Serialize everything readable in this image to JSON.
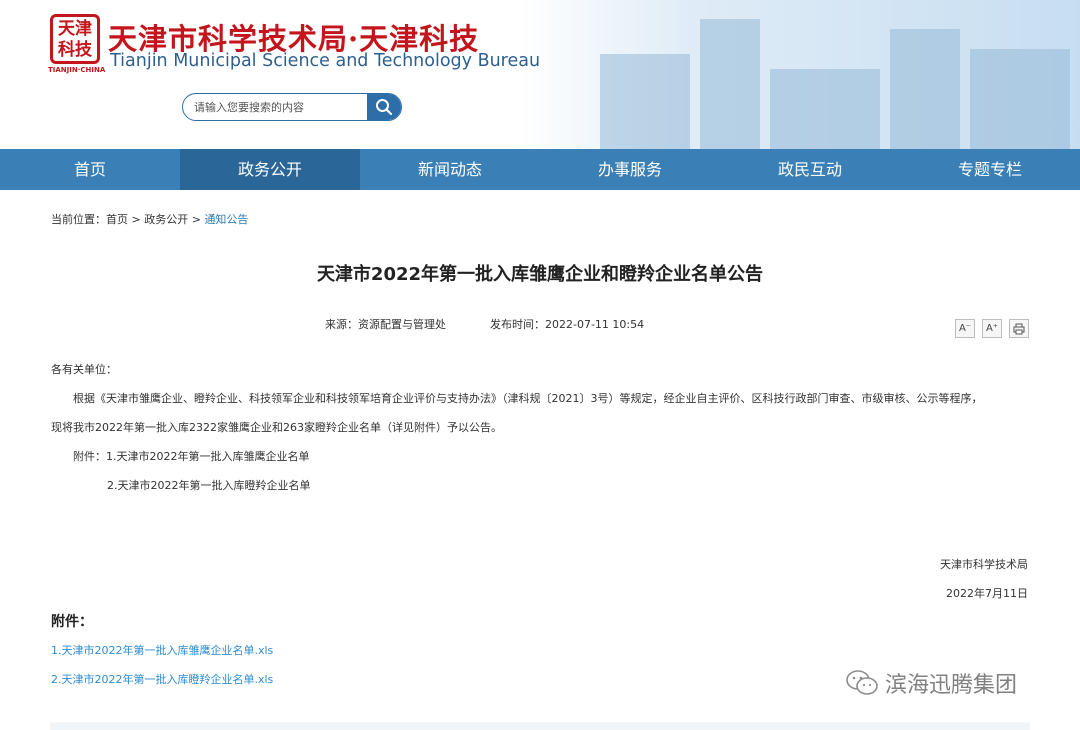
{
  "header": {
    "seal_text": "天津\n科技",
    "seal_caption": "TIANJIN·CHINA",
    "title": "天津市科学技术局·天津科技",
    "subtitle": "Tianjin Municipal Science and Technology Bureau",
    "search_placeholder": "请输入您要搜索的内容"
  },
  "nav": {
    "items": [
      {
        "label": "首页"
      },
      {
        "label": "政务公开"
      },
      {
        "label": "新闻动态"
      },
      {
        "label": "办事服务"
      },
      {
        "label": "政民互动"
      },
      {
        "label": "专题专栏"
      }
    ],
    "active_index": 1
  },
  "breadcrumb": {
    "prefix": "当前位置：",
    "home": "首页",
    "sep": " > ",
    "section": "政务公开",
    "current": "通知公告"
  },
  "article": {
    "title": "天津市2022年第一批入库雏鹰企业和瞪羚企业名单公告",
    "source": "来源：资源配置与管理处",
    "published": "发布时间：2022-07-11 10:54",
    "tools": {
      "font_smaller": "A⁻",
      "font_larger": "A⁺",
      "print": "⎙"
    },
    "salutation": "各有关单位：",
    "para_line1": "根据《天津市雏鹰企业、瞪羚企业、科技领军企业和科技领军培育企业评价与支持办法》（津科规〔2021〕3号）等规定，经企业自主评价、区科技行政部门审查、市级审核、公示等程序，",
    "para_line2": "现将我市2022年第一批入库2322家雏鹰企业和263家瞪羚企业名单（详见附件）予以公告。",
    "attach_line1": "附件：1.天津市2022年第一批入库雏鹰企业名单",
    "attach_line2": "2.天津市2022年第一批入库瞪羚企业名单",
    "signature": "天津市科学技术局",
    "date": "2022年7月11日"
  },
  "attachments": {
    "heading": "附件：",
    "files": [
      {
        "label": "1.天津市2022年第一批入库雏鹰企业名单.xls"
      },
      {
        "label": "2.天津市2022年第一批入库瞪羚企业名单.xls"
      }
    ]
  },
  "watermark": {
    "text": "滨海迅腾集团"
  },
  "colors": {
    "brand_red": "#c3151b",
    "nav_blue": "#3a7fb6",
    "nav_active": "#2a6798",
    "link_blue": "#2d8cd1"
  }
}
